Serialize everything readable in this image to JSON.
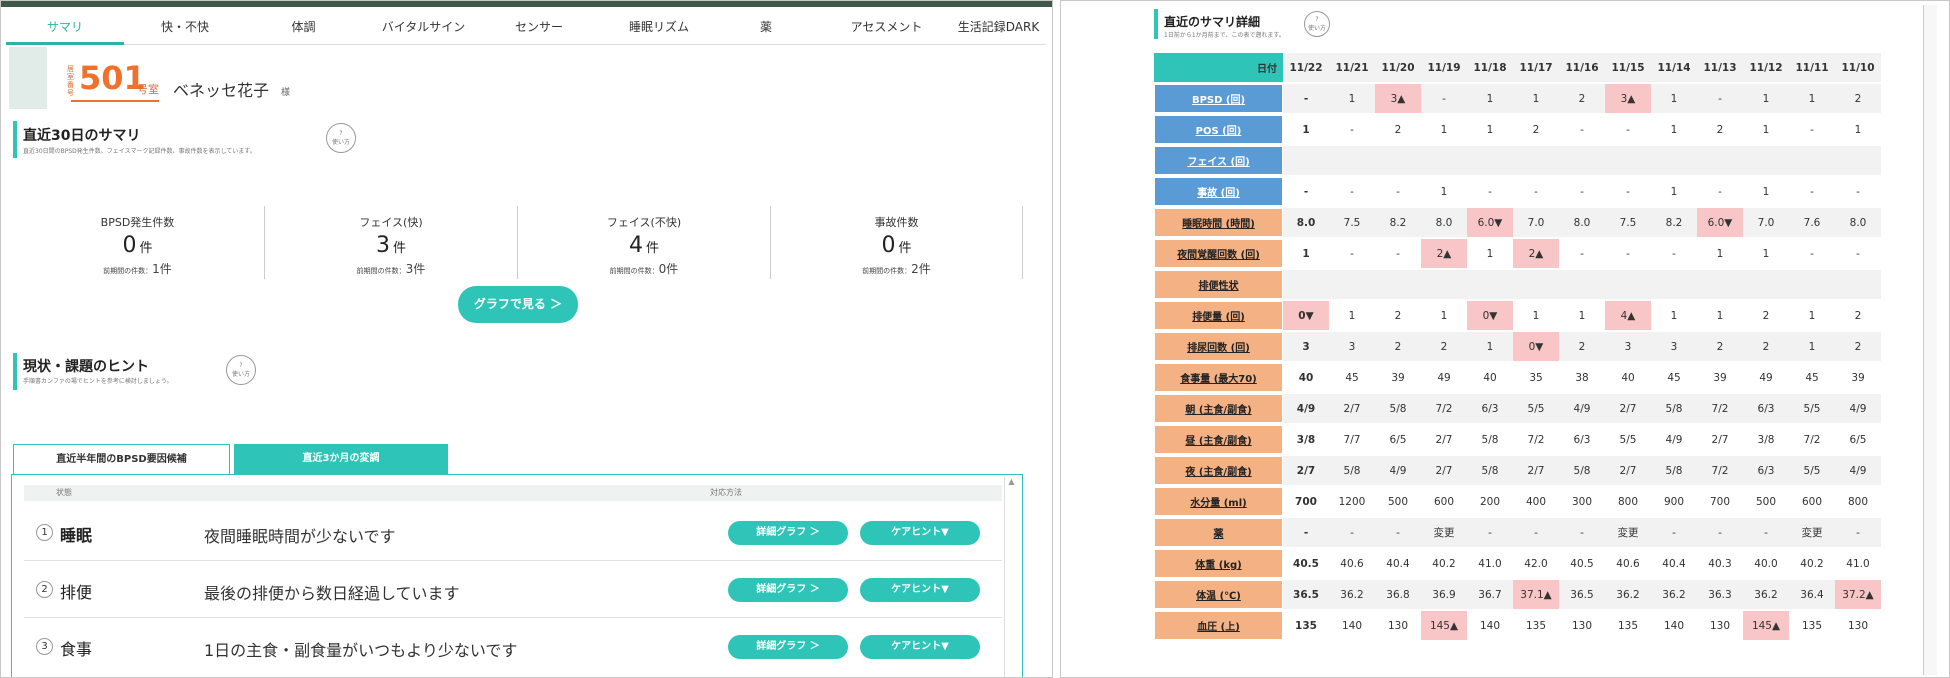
{
  "nav_tabs": [
    "サマリ",
    "快・不快",
    "体調",
    "バイタルサイン",
    "センサー",
    "睡眠リズム",
    "薬",
    "アセスメント",
    "生活記録DARK"
  ],
  "patient": {
    "room_label": "居室番号",
    "room_no": "501",
    "room_suffix": "号室",
    "name": "ベネッセ花子",
    "honorific": "様"
  },
  "summary": {
    "title": "直近30日のサマリ",
    "sub": "直近30日間のBPSD発生件数、フェイスマーク記録件数、事故件数を表示しています。",
    "help": "使い方",
    "stats": [
      {
        "label": "BPSD発生件数",
        "value": "0",
        "unit": "件",
        "prev_label": "前期間の件数：",
        "prev": "1件"
      },
      {
        "label": "フェイス(快)",
        "value": "3",
        "unit": "件",
        "prev_label": "前期間の件数：",
        "prev": "3件"
      },
      {
        "label": "フェイス(不快)",
        "value": "4",
        "unit": "件",
        "prev_label": "前期間の件数：",
        "prev": "0件"
      },
      {
        "label": "事故件数",
        "value": "0",
        "unit": "件",
        "prev_label": "前期間の件数：",
        "prev": "2件"
      }
    ],
    "graph_button": "グラフで見る ＞"
  },
  "hints": {
    "title": "現状・課題のヒント",
    "sub": "手順書カンファの場でヒントを参考に検討しましょう。",
    "help": "使い方",
    "tab_active": "直近半年間のBPSD要因候補",
    "tab_other": "直近3か月の変調",
    "col_state": "状態",
    "col_action": "対応方法",
    "detail_btn": "詳細グラフ ＞",
    "care_btn": "ケアヒント▼",
    "rows": [
      {
        "n": "1",
        "cat": "睡眠",
        "desc": "夜間睡眠時間が少ないです"
      },
      {
        "n": "2",
        "cat": "排便",
        "desc": "最後の排便から数日経過しています"
      },
      {
        "n": "3",
        "cat": "食事",
        "desc": "1日の主食・副食量がいつもより少ないです"
      }
    ]
  },
  "detail": {
    "title": "直近のサマリ詳細",
    "sub": "1日前から1か月前まで、この表で遡れます。",
    "help": "使い方",
    "date_label": "日付",
    "dates": [
      "11/22",
      "11/21",
      "11/20",
      "11/19",
      "11/18",
      "11/17",
      "11/16",
      "11/15",
      "11/14",
      "11/13",
      "11/12",
      "11/11",
      "11/10"
    ],
    "rows": [
      {
        "label": "BPSD (回)",
        "style": "blue",
        "vals": [
          "-",
          "1",
          "3▲",
          "-",
          "1",
          "1",
          "2",
          "3▲",
          "1",
          "-",
          "1",
          "1",
          "2"
        ],
        "pink": [
          2,
          7
        ]
      },
      {
        "label": "POS (回)",
        "style": "blue",
        "vals": [
          "1",
          "-",
          "2",
          "1",
          "1",
          "2",
          "-",
          "-",
          "1",
          "2",
          "1",
          "-",
          "1"
        ],
        "pink": []
      },
      {
        "label": "フェイス (回)",
        "style": "blue",
        "vals": [
          "",
          "",
          "",
          "",
          "",
          "",
          "",
          "",
          "",
          "",
          "",
          "",
          ""
        ],
        "pink": []
      },
      {
        "label": "事故 (回)",
        "style": "blue",
        "vals": [
          "-",
          "-",
          "-",
          "1",
          "-",
          "-",
          "-",
          "-",
          "1",
          "-",
          "1",
          "-",
          "-"
        ],
        "pink": []
      },
      {
        "label": "睡眠時間 (時間)",
        "style": "orng",
        "vals": [
          "8.0",
          "7.5",
          "8.2",
          "8.0",
          "6.0▼",
          "7.0",
          "8.0",
          "7.5",
          "8.2",
          "6.0▼",
          "7.0",
          "7.6",
          "8.0"
        ],
        "pink": [
          4,
          9
        ]
      },
      {
        "label": "夜間覚醒回数 (回)",
        "style": "orng",
        "vals": [
          "1",
          "-",
          "-",
          "2▲",
          "1",
          "2▲",
          "-",
          "-",
          "-",
          "1",
          "1",
          "-",
          "-"
        ],
        "pink": [
          3,
          5
        ]
      },
      {
        "label": "排便性状",
        "style": "orng",
        "vals": [
          "",
          "",
          "",
          "",
          "",
          "",
          "",
          "",
          "",
          "",
          "",
          "",
          ""
        ],
        "pink": []
      },
      {
        "label": "排便量 (回)",
        "style": "orng",
        "vals": [
          "0▼",
          "1",
          "2",
          "1",
          "0▼",
          "1",
          "1",
          "4▲",
          "1",
          "1",
          "2",
          "1",
          "2"
        ],
        "pink": [
          0,
          4,
          7
        ]
      },
      {
        "label": "排尿回数 (回)",
        "style": "orng",
        "vals": [
          "3",
          "3",
          "2",
          "2",
          "1",
          "0▼",
          "2",
          "3",
          "3",
          "2",
          "2",
          "1",
          "2"
        ],
        "pink": [
          5
        ]
      },
      {
        "label": "食事量 (最大70)",
        "style": "orng",
        "vals": [
          "40",
          "45",
          "39",
          "49",
          "40",
          "35",
          "38",
          "40",
          "45",
          "39",
          "49",
          "45",
          "39"
        ],
        "pink": []
      },
      {
        "label": "朝 (主食/副食)",
        "style": "orng",
        "vals": [
          "4/9",
          "2/7",
          "5/8",
          "7/2",
          "6/3",
          "5/5",
          "4/9",
          "2/7",
          "5/8",
          "7/2",
          "6/3",
          "5/5",
          "4/9"
        ],
        "pink": []
      },
      {
        "label": "昼 (主食/副食)",
        "style": "orng",
        "vals": [
          "3/8",
          "7/7",
          "6/5",
          "2/7",
          "5/8",
          "7/2",
          "6/3",
          "5/5",
          "4/9",
          "2/7",
          "3/8",
          "7/2",
          "6/5"
        ],
        "pink": []
      },
      {
        "label": "夜 (主食/副食)",
        "style": "orng",
        "vals": [
          "2/7",
          "5/8",
          "4/9",
          "2/7",
          "5/8",
          "2/7",
          "5/8",
          "2/7",
          "5/8",
          "7/2",
          "6/3",
          "5/5",
          "4/9"
        ],
        "pink": []
      },
      {
        "label": "水分量 (ml)",
        "style": "orng",
        "vals": [
          "700",
          "1200",
          "500",
          "600",
          "200",
          "400",
          "300",
          "800",
          "900",
          "700",
          "500",
          "600",
          "800"
        ],
        "pink": []
      },
      {
        "label": "薬",
        "style": "orng",
        "vals": [
          "-",
          "-",
          "-",
          "変更",
          "-",
          "-",
          "-",
          "変更",
          "-",
          "-",
          "-",
          "変更",
          "-"
        ],
        "pink": [],
        "links": [
          3,
          7,
          11
        ]
      },
      {
        "label": "体重 (kg)",
        "style": "orng",
        "vals": [
          "40.5",
          "40.6",
          "40.4",
          "40.2",
          "41.0",
          "42.0",
          "40.5",
          "40.6",
          "40.4",
          "40.3",
          "40.0",
          "40.2",
          "41.0"
        ],
        "pink": []
      },
      {
        "label": "体温 (℃)",
        "style": "orng",
        "vals": [
          "36.5",
          "36.2",
          "36.8",
          "36.9",
          "36.7",
          "37.1▲",
          "36.5",
          "36.2",
          "36.2",
          "36.3",
          "36.2",
          "36.4",
          "37.2▲"
        ],
        "pink": [
          5,
          12
        ]
      },
      {
        "label": "血圧 (上)",
        "style": "orng",
        "vals": [
          "135",
          "140",
          "130",
          "145▲",
          "140",
          "135",
          "130",
          "135",
          "140",
          "130",
          "145▲",
          "135",
          "130"
        ],
        "pink": [
          3,
          10
        ]
      }
    ]
  }
}
